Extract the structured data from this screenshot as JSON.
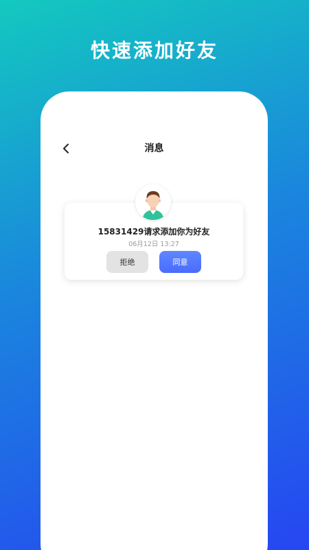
{
  "promo": {
    "title": "快速添加好友"
  },
  "app": {
    "nav_title": "消息",
    "icons": {
      "back": "chevron-left-icon",
      "avatar": "user-avatar"
    }
  },
  "friend_request": {
    "message": "15831429请求添加你为好友",
    "timestamp": "06月12日 13:27",
    "reject_label": "拒绝",
    "accept_label": "同意"
  },
  "colors": {
    "gradient_top": "#13c9bf",
    "gradient_bottom": "#2646f2",
    "accept_button": "#4a6bff",
    "reject_button": "#e3e3e3"
  }
}
